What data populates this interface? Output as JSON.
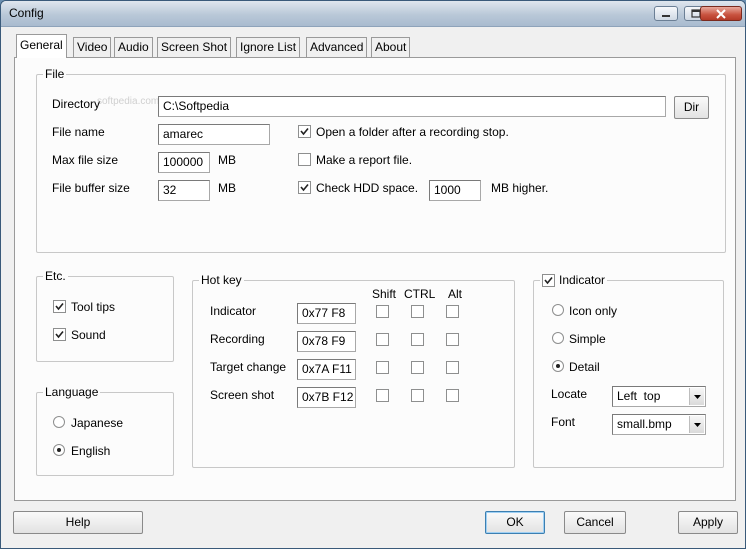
{
  "window": {
    "title": "Config"
  },
  "tabs": [
    {
      "label": "General",
      "active": true
    },
    {
      "label": "Video"
    },
    {
      "label": "Audio"
    },
    {
      "label": "Screen Shot"
    },
    {
      "label": "Ignore List"
    },
    {
      "label": "Advanced"
    },
    {
      "label": "About"
    }
  ],
  "watermark": "softpedia.com",
  "file": {
    "group_label": "File",
    "directory_label": "Directory",
    "directory_value": "C:\\Softpedia",
    "dir_button": "Dir",
    "filename_label": "File name",
    "filename_value": "amarec",
    "maxsize_label": "Max file size",
    "maxsize_value": "100000",
    "maxsize_unit": "MB",
    "buffer_label": "File buffer size",
    "buffer_value": "32",
    "buffer_unit": "MB",
    "open_folder_label": "Open a folder after a recording stop.",
    "open_folder_checked": true,
    "report_label": "Make a report file.",
    "report_checked": false,
    "hdd_label": "Check HDD space.",
    "hdd_checked": true,
    "hdd_value": "1000",
    "hdd_unit": "MB higher."
  },
  "etc": {
    "group_label": "Etc.",
    "tooltips_label": "Tool tips",
    "tooltips_checked": true,
    "sound_label": "Sound",
    "sound_checked": true
  },
  "language": {
    "group_label": "Language",
    "japanese_label": "Japanese",
    "english_label": "English",
    "selected": "English"
  },
  "hotkey": {
    "group_label": "Hot key",
    "col_shift": "Shift",
    "col_ctrl": "CTRL",
    "col_alt": "Alt",
    "rows": [
      {
        "label": "Indicator",
        "key": "0x77 F8"
      },
      {
        "label": "Recording",
        "key": "0x78 F9"
      },
      {
        "label": "Target change",
        "key": "0x7A F11"
      },
      {
        "label": "Screen shot",
        "key": "0x7B F12"
      }
    ]
  },
  "indicator": {
    "group_label": "Indicator",
    "enabled": true,
    "icon_only_label": "Icon only",
    "simple_label": "Simple",
    "detail_label": "Detail",
    "selected": "Detail",
    "locate_label": "Locate",
    "locate_value": "Left  top",
    "font_label": "Font",
    "font_value": "small.bmp"
  },
  "footer": {
    "help": "Help",
    "ok": "OK",
    "cancel": "Cancel",
    "apply": "Apply"
  },
  "icons": {
    "minimize": "minimize-icon",
    "maximize": "maximize-icon",
    "close": "close-icon",
    "check": "checkmark-icon",
    "dropdown": "chevron-down-icon"
  }
}
